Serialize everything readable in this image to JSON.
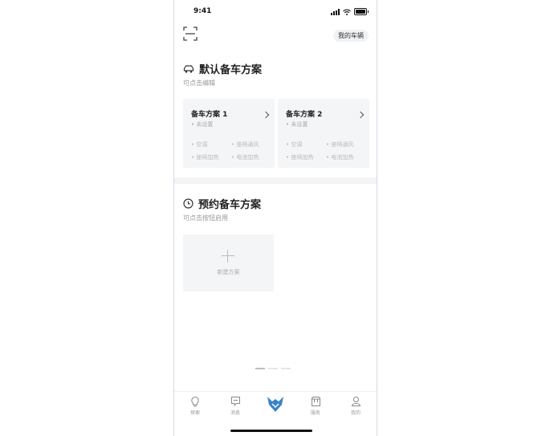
{
  "status_bar": {
    "time": "9:41"
  },
  "header": {
    "my_vehicle_label": "我的车辆"
  },
  "default_section": {
    "title": "默认备车方案",
    "subtitle": "可点击编辑",
    "plans": [
      {
        "name": "备车方案 1",
        "status": "未设置",
        "features": [
          "空调",
          "座椅通风",
          "座椅加热",
          "电池加热"
        ]
      },
      {
        "name": "备车方案 2",
        "status": "未设置",
        "features": [
          "空调",
          "座椅通风",
          "座椅加热",
          "电池加热"
        ]
      }
    ]
  },
  "scheduled_section": {
    "title": "预约备车方案",
    "subtitle": "可点击按钮启用",
    "new_plan_label": "新建方案"
  },
  "tabbar": {
    "items": [
      {
        "label": "探索",
        "icon": "bulb-icon"
      },
      {
        "label": "消息",
        "icon": "message-icon"
      },
      {
        "label": "",
        "icon": "brand-logo-icon"
      },
      {
        "label": "服务",
        "icon": "store-icon"
      },
      {
        "label": "我的",
        "icon": "profile-icon"
      }
    ]
  },
  "colors": {
    "brand_blue": "#3a83c9",
    "accent": "#3a83c9"
  }
}
